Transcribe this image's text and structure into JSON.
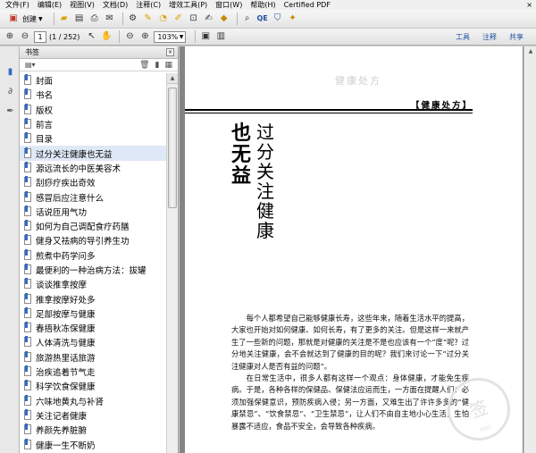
{
  "menu": [
    "文件(F)",
    "编辑(E)",
    "视图(V)",
    "文档(D)",
    "注释(C)",
    "增效工具(P)",
    "窗口(W)",
    "帮助(H)",
    "Certified PDF"
  ],
  "menu_close": "×",
  "toolbar": {
    "create_label": "创建",
    "page_current": "1",
    "page_count": "(1 / 252)",
    "zoom": "103%",
    "right_links": [
      "工具",
      "注释",
      "共享"
    ]
  },
  "panel": {
    "title": "书签",
    "options_glyph": "▤▾"
  },
  "bookmarks": [
    "封面",
    "书名",
    "版权",
    "前言",
    "目录",
    "过分关注健康也无益",
    "源远流长的中医美容术",
    "刮痧疗疾出奇效",
    "感冒后应注意什么",
    "话说匝用气功",
    "如何为自己调配食疗药膳",
    "健身又祛病的导引养生功",
    "煎煮中药学问多",
    "最便利的一种治病方法：拔罐",
    "谈谈推拿按摩",
    "推拿按摩好处多",
    "足部按摩与健康",
    "春捂秋冻保健康",
    "人体清洗与健康",
    "旅游热里话旅游",
    "治疾追着节气走",
    "科学饮食保健康",
    "六味地黄丸与补肾",
    "关注记者健康",
    "养颜先养脏腑",
    "健康一生不断奶"
  ],
  "selected_bookmark": 5,
  "document": {
    "ghost_header": "健康处方",
    "section_tag": "【健康处方】",
    "title_bold": "也无益",
    "title_main": "过分关注健康",
    "paragraphs": [
      "每个人都希望自己能够健康长寿，这些年来，随着生活水平的提高，大家也开始对如何健康、如何长寿，有了更多的关注。但是这样一来就产生了一些新的问题，那就是对健康的关注是不是也应该有一个“度”呢？过分地关注健康，会不会就达到了健康的目的呢？我们来讨论一下“过分关注健康对人是否有益的问题”。",
      "在日常生活中，很多人都有这样一个观点：身体健康，才能免生疾病。于是，各种各样的保健品、保健法应运而生，一方面在提醒人们：必须加强保健意识，预防疾病入侵；另一方面，又难生出了许许多多的“健康禁忌”、“饮食禁忌”、“卫生禁忌”，让人们不由自主地小心生活，生怕暴露不适应，食品不安全，会导致各种疾病。"
    ],
    "watermark": "签",
    "watermark_sub": "PDG"
  }
}
